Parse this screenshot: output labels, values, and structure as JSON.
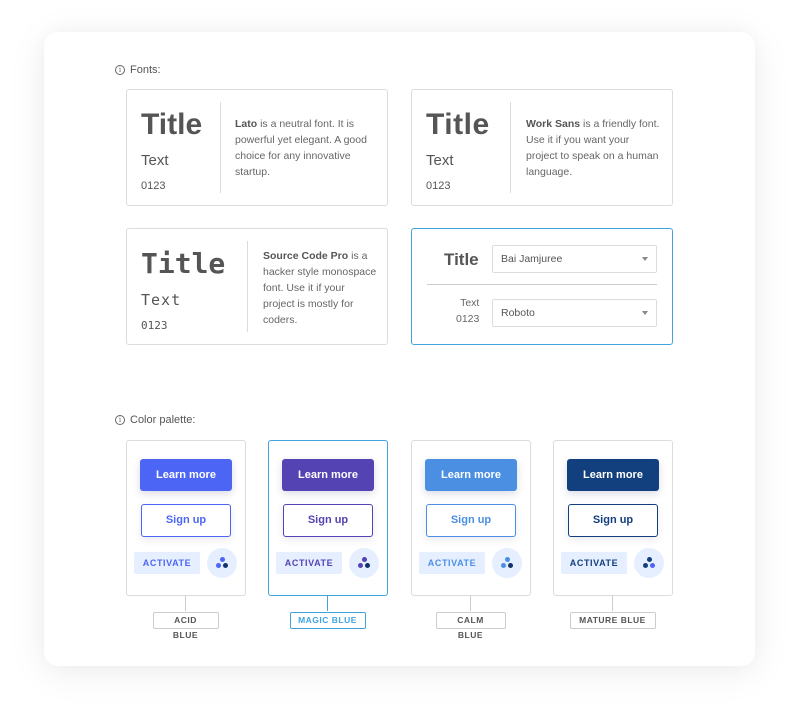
{
  "fonts_section": {
    "label": "Fonts:",
    "cards": [
      {
        "title": "Title",
        "text": "Text",
        "numbers": "0123",
        "font_name": "Lato",
        "description": " is a neutral font. It is powerful yet elegant. A good choice for any innovative startup."
      },
      {
        "title": "Title",
        "text": "Text",
        "numbers": "0123",
        "font_name": "Work Sans",
        "description": " is a friendly font. Use it if you want your project to speak on a human language."
      },
      {
        "title": "Title",
        "text": "Text",
        "numbers": "0123",
        "font_name": "Source Code Pro",
        "description": " is a hacker style monospace font. Use it if your project is mostly for coders."
      }
    ],
    "custom_pair": {
      "title_label": "Title",
      "text_label": "Text",
      "numbers_label": "0123",
      "title_font_selected": "Bai Jamjuree",
      "text_font_selected": "Roboto",
      "selected": true
    }
  },
  "palette_section": {
    "label": "Color palette:",
    "palettes": [
      {
        "name": "ACID BLUE",
        "primary_label": "Learn more",
        "outline_label": "Sign up",
        "flat_label": "ACTIVATE",
        "colors": {
          "primary": "#4d65f5",
          "text": "#4d65f5",
          "dot_a": "#4d65f5",
          "dot_b": "#4d65f5",
          "dot_c": "#12326b"
        },
        "selected": false
      },
      {
        "name": "MAGIC BLUE",
        "primary_label": "Learn more",
        "outline_label": "Sign up",
        "flat_label": "ACTIVATE",
        "colors": {
          "primary": "#5443b2",
          "text": "#5443b2",
          "dot_a": "#5443b2",
          "dot_b": "#5443b2",
          "dot_c": "#12326b"
        },
        "selected": true
      },
      {
        "name": "CALM BLUE",
        "primary_label": "Learn more",
        "outline_label": "Sign up",
        "flat_label": "ACTIVATE",
        "colors": {
          "primary": "#4a8fe2",
          "text": "#4a8fe2",
          "dot_a": "#4a8fe2",
          "dot_b": "#4a8fe2",
          "dot_c": "#12326b"
        },
        "selected": false
      },
      {
        "name": "MATURE BLUE",
        "primary_label": "Learn more",
        "outline_label": "Sign up",
        "flat_label": "ACTIVATE",
        "colors": {
          "primary": "#123f7d",
          "text": "#123f7d",
          "dot_a": "#123f7d",
          "dot_b": "#123f7d",
          "dot_c": "#4d65f5"
        },
        "selected": false
      }
    ]
  },
  "colors": {
    "selection_border": "#41a3e0",
    "flat_background": "#e6efff"
  }
}
